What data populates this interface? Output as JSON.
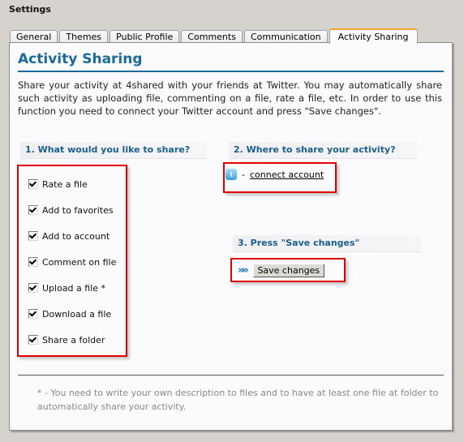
{
  "page": {
    "title": "Settings"
  },
  "tabs": [
    {
      "label": "General",
      "active": false
    },
    {
      "label": "Themes",
      "active": false
    },
    {
      "label": "Public Profile",
      "active": false
    },
    {
      "label": "Comments",
      "active": false
    },
    {
      "label": "Communication",
      "active": false
    },
    {
      "label": "Activity Sharing",
      "active": true
    }
  ],
  "panel": {
    "heading": "Activity Sharing",
    "intro": "Share your activity at 4shared with your friends at Twitter. You may automatically share such activity as uploading file, commenting on a file, rate a file, etc. In order to use this function you need to connect your Twitter account and press \"Save changes\".",
    "section1": {
      "title": "1. What would you like to share?",
      "options": [
        {
          "label": "Rate a file",
          "checked": true
        },
        {
          "label": "Add to favorites",
          "checked": true
        },
        {
          "label": "Add to account",
          "checked": true
        },
        {
          "label": "Comment on file",
          "checked": true
        },
        {
          "label": "Upload a file *",
          "checked": true
        },
        {
          "label": "Download a file",
          "checked": true
        },
        {
          "label": "Share a folder",
          "checked": true
        }
      ]
    },
    "section2": {
      "title": "2. Where to share your activity?",
      "service_icon": "twitter-icon",
      "separator": "-",
      "connect_label": "connect account"
    },
    "section3": {
      "title": "3. Press \"Save changes\"",
      "button_label": "Save changes"
    },
    "footnote": "* - You need to write your own description to files and to have at least one file at folder to automatically share your activity."
  },
  "colors": {
    "accent": "#1a6a9a",
    "active_tab_border": "#f7a530",
    "highlight": "#e00000"
  }
}
